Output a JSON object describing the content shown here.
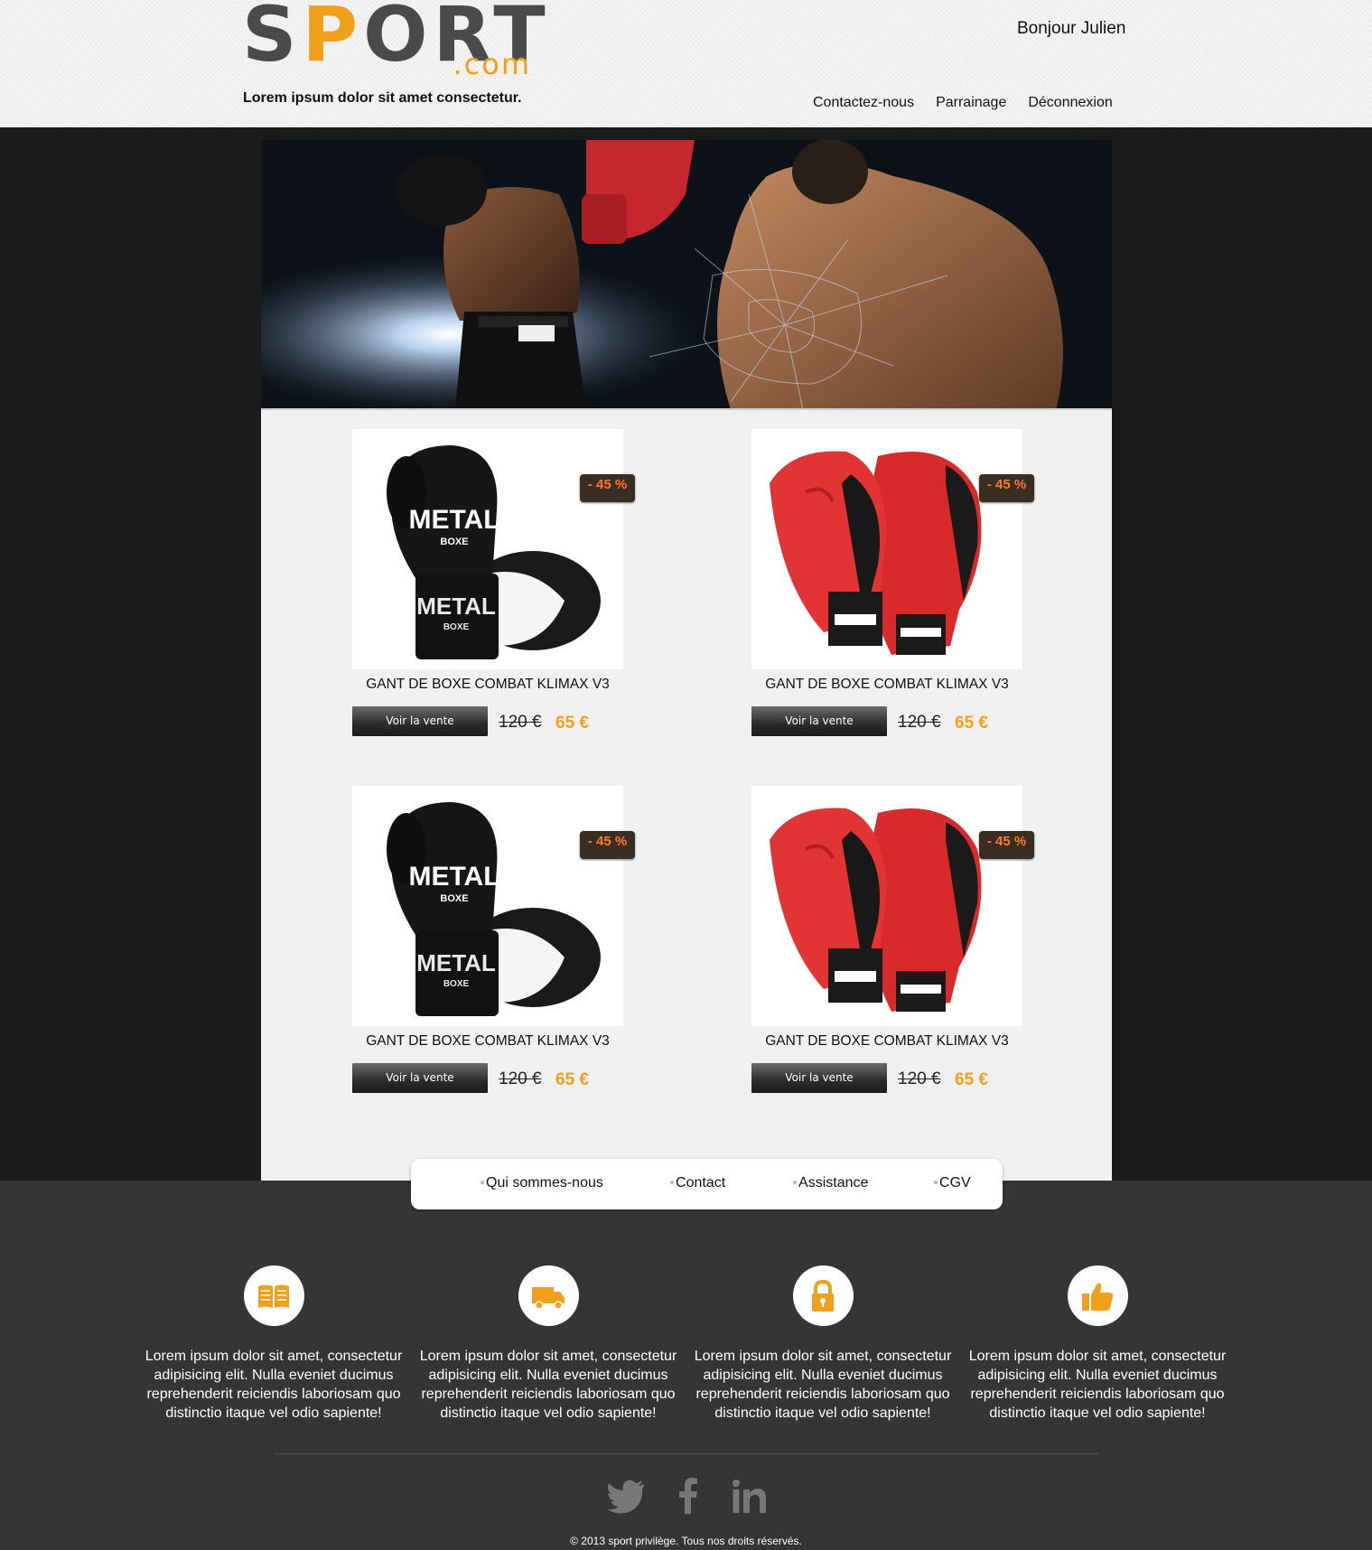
{
  "header": {
    "logo_main_pre": "S",
    "logo_main_accent": "P",
    "logo_main_post": "ORT",
    "logo_suffix": ".com",
    "tagline": "Lorem ipsum dolor sit amet consectetur.",
    "greeting": "Bonjour Julien",
    "nav": [
      "Contactez-nous",
      "Parrainage",
      "Déconnexion"
    ]
  },
  "products": [
    {
      "title": "GANT DE BOXE COMBAT KLIMAX V3",
      "badge": "- 45 %",
      "button": "Voir la vente",
      "old_price": "120 €",
      "new_price": "65 €",
      "glove_color": "black"
    },
    {
      "title": "GANT DE BOXE COMBAT KLIMAX V3",
      "badge": "- 45 %",
      "button": "Voir la vente",
      "old_price": "120 €",
      "new_price": "65 €",
      "glove_color": "red"
    },
    {
      "title": "GANT DE BOXE COMBAT KLIMAX V3",
      "badge": "- 45 %",
      "button": "Voir la vente",
      "old_price": "120 €",
      "new_price": "65 €",
      "glove_color": "black"
    },
    {
      "title": "GANT DE BOXE COMBAT KLIMAX V3",
      "badge": "- 45 %",
      "button": "Voir la vente",
      "old_price": "120 €",
      "new_price": "65 €",
      "glove_color": "red"
    }
  ],
  "glove_labels": {
    "metal": "METAL",
    "boxe": "BOXE"
  },
  "footer_nav": [
    "Qui sommes-nous",
    "Contact",
    "Assistance",
    "CGV"
  ],
  "features": [
    {
      "icon": "book-icon",
      "text": "Lorem ipsum dolor sit amet, consectetur adipisicing elit. Nulla eveniet ducimus reprehenderit reiciendis laboriosam quo distinctio itaque vel odio sapiente!"
    },
    {
      "icon": "truck-icon",
      "text": "Lorem ipsum dolor sit amet, consectetur adipisicing elit. Nulla eveniet ducimus reprehenderit reiciendis laboriosam quo distinctio itaque vel odio sapiente!"
    },
    {
      "icon": "lock-icon",
      "text": "Lorem ipsum dolor sit amet, consectetur adipisicing elit. Nulla eveniet ducimus reprehenderit reiciendis laboriosam quo distinctio itaque vel odio sapiente!"
    },
    {
      "icon": "thumbs-up-icon",
      "text": "Lorem ipsum dolor sit amet, consectetur adipisicing elit. Nulla eveniet ducimus reprehenderit reiciendis laboriosam quo distinctio itaque vel odio sapiente!"
    }
  ],
  "social": [
    "twitter-icon",
    "facebook-icon",
    "linkedin-icon"
  ],
  "copyright": "© 2013 sport privilège. Tous nos droits réservés.",
  "colors": {
    "accent": "#f0a01b",
    "badge_text": "#ff7a2a",
    "dark_bg": "#1b1b1b",
    "footer_bg": "#353535"
  }
}
